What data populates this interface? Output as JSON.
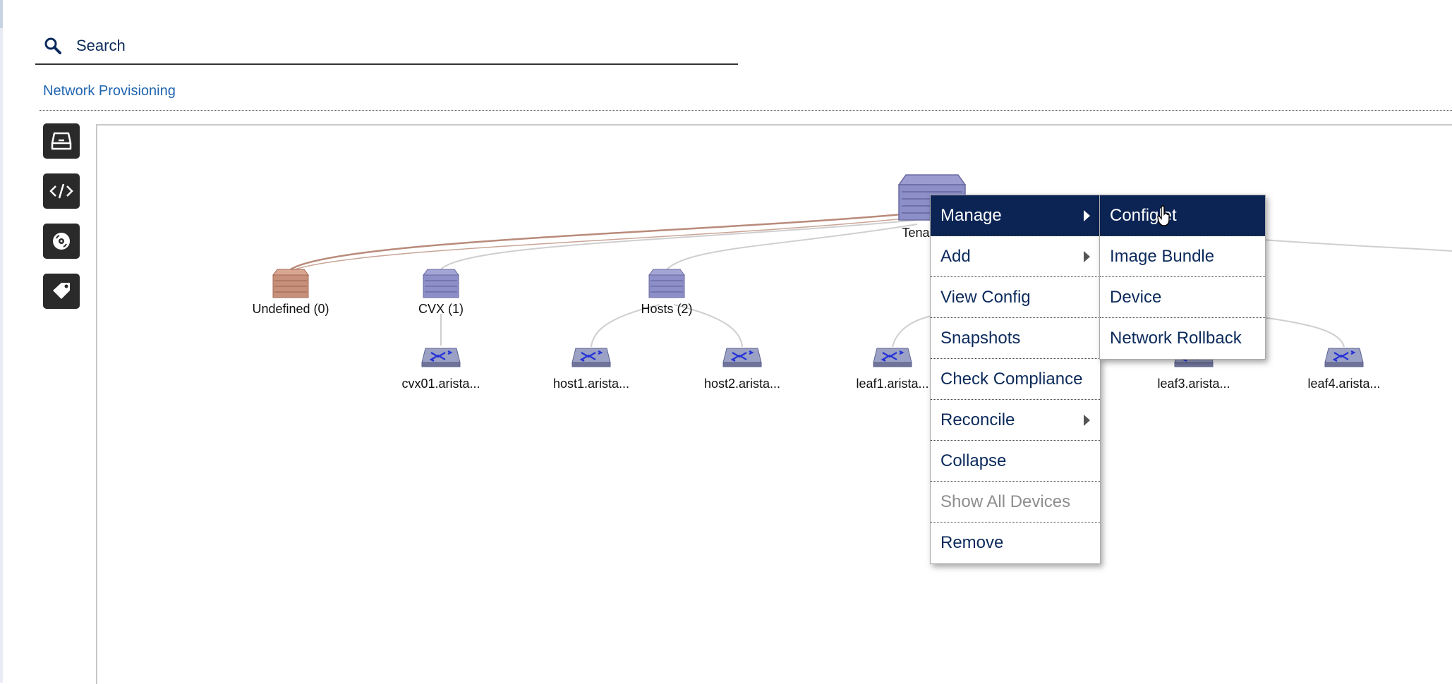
{
  "search": {
    "placeholder": "Search"
  },
  "breadcrumb": {
    "label": "Network Provisioning"
  },
  "toolbar": [
    {
      "name": "inbox-icon"
    },
    {
      "name": "code-icon"
    },
    {
      "name": "disc-icon"
    },
    {
      "name": "tag-icon"
    }
  ],
  "topology": {
    "root": {
      "label": "Tena"
    },
    "containers": [
      {
        "label": "Undefined (0)",
        "color": "#c6907a"
      },
      {
        "label": "CVX (1)",
        "color": "#8d8fc8"
      },
      {
        "label": "Hosts (2)",
        "color": "#8d8fc8"
      }
    ],
    "devices": [
      {
        "label": "cvx01.arista..."
      },
      {
        "label": "host1.arista..."
      },
      {
        "label": "host2.arista..."
      },
      {
        "label": "leaf1.arista..."
      },
      {
        "label": "leaf3.arista..."
      },
      {
        "label": "leaf4.arista..."
      }
    ]
  },
  "context_menu": {
    "items": [
      {
        "label": "Manage",
        "submenu": true,
        "active": true
      },
      {
        "label": "Add",
        "submenu": true
      },
      {
        "label": "View Config"
      },
      {
        "label": "Snapshots"
      },
      {
        "label": "Check Compliance"
      },
      {
        "label": "Reconcile",
        "submenu": true
      },
      {
        "label": "Collapse"
      },
      {
        "label": "Show All Devices",
        "disabled": true
      },
      {
        "label": "Remove"
      }
    ]
  },
  "submenu": {
    "items": [
      {
        "label": "Configlet",
        "active": true
      },
      {
        "label": "Image Bundle"
      },
      {
        "label": "Device"
      },
      {
        "label": "Network Rollback"
      }
    ]
  },
  "colors": {
    "menu_active": "#0c2454",
    "text": "#0b2a5b",
    "link": "#1f64b0",
    "undefined_edge": "#b98a7a",
    "edge": "#cccccc"
  }
}
